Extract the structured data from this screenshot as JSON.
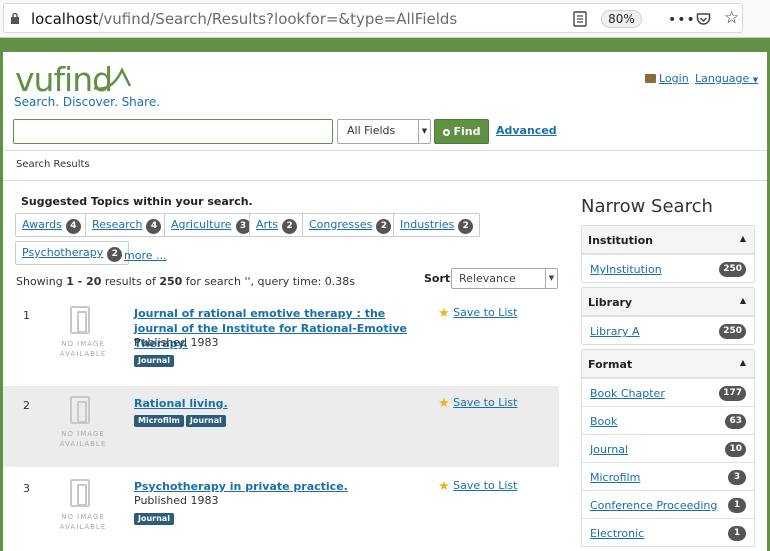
{
  "browser": {
    "url_host": "localhost",
    "url_path": "/vufind/Search/Results?lookfor=&type=AllFields",
    "zoom": "80%"
  },
  "header": {
    "logo": "vufind",
    "tagline": "Search. Discover. Share.",
    "login": "Login",
    "language": "Language"
  },
  "search": {
    "query": "",
    "type": "All Fields",
    "find": "Find",
    "advanced": "Advanced"
  },
  "breadcrumb": "Search Results",
  "suggested": {
    "title": "Suggested Topics within your search.",
    "topics": [
      {
        "label": "Awards",
        "count": "4"
      },
      {
        "label": "Research",
        "count": "4"
      },
      {
        "label": "Agriculture",
        "count": "3"
      },
      {
        "label": "Arts",
        "count": "2"
      },
      {
        "label": "Congresses",
        "count": "2"
      },
      {
        "label": "Industries",
        "count": "2"
      },
      {
        "label": "Psychotherapy",
        "count": "2"
      }
    ],
    "more": "more ..."
  },
  "summary": {
    "prefix": "Showing ",
    "range": "1 - 20",
    "middle": " results of ",
    "total": "250",
    "suffix": " for search '', query time: 0.38s"
  },
  "sort": {
    "label": "Sort",
    "value": "Relevance"
  },
  "no_image": "NO IMAGE AVAILABLE",
  "save_label": "Save to List",
  "results": [
    {
      "num": "1",
      "title": "Journal of rational emotive therapy : the journal of the Institute for Rational-Emotive Therapy.",
      "published": "Published 1983",
      "formats": [
        "Journal"
      ]
    },
    {
      "num": "2",
      "title": "Rational living.",
      "published": "",
      "formats": [
        "Microfilm",
        "Journal"
      ]
    },
    {
      "num": "3",
      "title": "Psychotherapy in private practice.",
      "published": "Published 1983",
      "formats": [
        "Journal"
      ]
    }
  ],
  "sidebar": {
    "title": "Narrow Search",
    "facets": [
      {
        "name": "Institution",
        "items": [
          {
            "label": "MyInstitution",
            "count": "250"
          }
        ]
      },
      {
        "name": "Library",
        "items": [
          {
            "label": "Library A",
            "count": "250"
          }
        ]
      },
      {
        "name": "Format",
        "items": [
          {
            "label": "Book Chapter",
            "count": "177"
          },
          {
            "label": "Book",
            "count": "63"
          },
          {
            "label": "Journal",
            "count": "10"
          },
          {
            "label": "Microfilm",
            "count": "3"
          },
          {
            "label": "Conference Proceeding",
            "count": "1"
          },
          {
            "label": "Electronic",
            "count": "1"
          }
        ]
      }
    ]
  },
  "colors": {
    "brand_green": "#619144",
    "link_blue": "#1a6fa8",
    "format_tag": "#2b5c7a"
  }
}
